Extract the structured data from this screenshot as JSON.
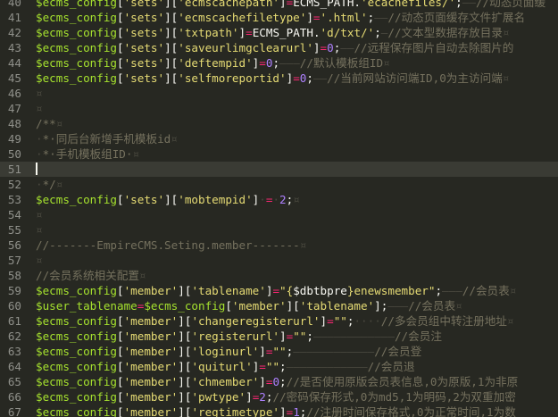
{
  "editor": {
    "theme_bg": "#272822",
    "active_line": 51,
    "lines": [
      {
        "n": "40",
        "tokens": [
          [
            "var",
            "$ecms_config"
          ],
          [
            "bracket",
            "["
          ],
          [
            "key",
            "'sets'"
          ],
          [
            "bracket",
            "]["
          ],
          [
            "key",
            "'ecmscachepath'"
          ],
          [
            "bracket",
            "]"
          ],
          [
            "op",
            "="
          ],
          [
            "plain",
            "ECMS_PATH."
          ],
          [
            "str",
            "'ecachefiles/'"
          ],
          [
            "plain",
            ";"
          ],
          [
            "ws",
            "——"
          ],
          [
            "comment",
            "//动态页面缓"
          ]
        ]
      },
      {
        "n": "41",
        "tokens": [
          [
            "var",
            "$ecms_config"
          ],
          [
            "bracket",
            "["
          ],
          [
            "key",
            "'sets'"
          ],
          [
            "bracket",
            "]["
          ],
          [
            "key",
            "'ecmscachefiletype'"
          ],
          [
            "bracket",
            "]"
          ],
          [
            "op",
            "="
          ],
          [
            "str",
            "'.html'"
          ],
          [
            "plain",
            ";"
          ],
          [
            "ws",
            "——"
          ],
          [
            "comment",
            "//动态页面缓存文件扩展名"
          ]
        ]
      },
      {
        "n": "42",
        "tokens": [
          [
            "var",
            "$ecms_config"
          ],
          [
            "bracket",
            "["
          ],
          [
            "key",
            "'sets'"
          ],
          [
            "bracket",
            "]["
          ],
          [
            "key",
            "'txtpath'"
          ],
          [
            "bracket",
            "]"
          ],
          [
            "op",
            "="
          ],
          [
            "plain",
            "ECMS_PATH."
          ],
          [
            "str",
            "'d/txt/'"
          ],
          [
            "plain",
            ";"
          ],
          [
            "ws",
            "—"
          ],
          [
            "comment",
            "//文本型数据存放目录"
          ],
          [
            "ws",
            "¤"
          ]
        ]
      },
      {
        "n": "43",
        "tokens": [
          [
            "var",
            "$ecms_config"
          ],
          [
            "bracket",
            "["
          ],
          [
            "key",
            "'sets'"
          ],
          [
            "bracket",
            "]["
          ],
          [
            "key",
            "'saveurlimgclearurl'"
          ],
          [
            "bracket",
            "]"
          ],
          [
            "op",
            "="
          ],
          [
            "num",
            "0"
          ],
          [
            "plain",
            ";"
          ],
          [
            "ws",
            "——"
          ],
          [
            "comment",
            "//远程保存图片自动去除图片的"
          ]
        ]
      },
      {
        "n": "44",
        "tokens": [
          [
            "var",
            "$ecms_config"
          ],
          [
            "bracket",
            "["
          ],
          [
            "key",
            "'sets'"
          ],
          [
            "bracket",
            "]["
          ],
          [
            "key",
            "'deftempid'"
          ],
          [
            "bracket",
            "]"
          ],
          [
            "op",
            "="
          ],
          [
            "num",
            "0"
          ],
          [
            "plain",
            ";"
          ],
          [
            "ws",
            "———"
          ],
          [
            "comment",
            "//默认模板组ID"
          ],
          [
            "ws",
            "¤"
          ]
        ]
      },
      {
        "n": "45",
        "tokens": [
          [
            "var",
            "$ecms_config"
          ],
          [
            "bracket",
            "["
          ],
          [
            "key",
            "'sets'"
          ],
          [
            "bracket",
            "]["
          ],
          [
            "key",
            "'selfmoreportid'"
          ],
          [
            "bracket",
            "]"
          ],
          [
            "op",
            "="
          ],
          [
            "num",
            "0"
          ],
          [
            "plain",
            ";"
          ],
          [
            "ws",
            "——"
          ],
          [
            "comment",
            "//当前网站访问端ID,0为主访问端"
          ],
          [
            "ws",
            "¤"
          ]
        ]
      },
      {
        "n": "46",
        "tokens": [
          [
            "ws",
            "¤"
          ]
        ]
      },
      {
        "n": "47",
        "tokens": [
          [
            "ws",
            "¤"
          ]
        ]
      },
      {
        "n": "48",
        "tokens": [
          [
            "comment",
            "/**"
          ],
          [
            "ws",
            "¤"
          ]
        ]
      },
      {
        "n": "49",
        "tokens": [
          [
            "ws",
            "·"
          ],
          [
            "comment",
            "*·同后台新增手机模板id"
          ],
          [
            "ws",
            "¤"
          ]
        ]
      },
      {
        "n": "50",
        "tokens": [
          [
            "ws",
            "·"
          ],
          [
            "comment",
            "*·手机模板组ID·"
          ],
          [
            "ws",
            "¤"
          ]
        ]
      },
      {
        "n": "51",
        "tokens": [
          [
            "cursor",
            ""
          ]
        ]
      },
      {
        "n": "52",
        "tokens": [
          [
            "ws",
            "·"
          ],
          [
            "comment",
            "*/"
          ],
          [
            "ws",
            "¤"
          ]
        ]
      },
      {
        "n": "53",
        "tokens": [
          [
            "var",
            "$ecms_config"
          ],
          [
            "bracket",
            "["
          ],
          [
            "key",
            "'sets'"
          ],
          [
            "bracket",
            "]["
          ],
          [
            "key",
            "'mobtempid'"
          ],
          [
            "bracket",
            "]"
          ],
          [
            "ws",
            "·"
          ],
          [
            "op",
            "="
          ],
          [
            "ws",
            "·"
          ],
          [
            "num",
            "2"
          ],
          [
            "plain",
            ";"
          ],
          [
            "ws",
            "¤"
          ]
        ]
      },
      {
        "n": "54",
        "tokens": [
          [
            "ws",
            "¤"
          ]
        ]
      },
      {
        "n": "55",
        "tokens": [
          [
            "ws",
            "¤"
          ]
        ]
      },
      {
        "n": "56",
        "tokens": [
          [
            "comment",
            "//-------EmpireCMS.Seting.member-------"
          ],
          [
            "ws",
            "¤"
          ]
        ]
      },
      {
        "n": "57",
        "tokens": [
          [
            "ws",
            "¤"
          ]
        ]
      },
      {
        "n": "58",
        "tokens": [
          [
            "comment",
            "//会员系统相关配置"
          ],
          [
            "ws",
            "¤"
          ]
        ]
      },
      {
        "n": "59",
        "tokens": [
          [
            "var",
            "$ecms_config"
          ],
          [
            "bracket",
            "["
          ],
          [
            "key",
            "'member'"
          ],
          [
            "bracket",
            "]["
          ],
          [
            "key",
            "'tablename'"
          ],
          [
            "bracket",
            "]"
          ],
          [
            "op",
            "="
          ],
          [
            "str",
            "\"{"
          ],
          [
            "plain",
            "$dbtbpre"
          ],
          [
            "str",
            "}enewsmember\""
          ],
          [
            "plain",
            ";"
          ],
          [
            "ws",
            "———"
          ],
          [
            "comment",
            "//会员表"
          ],
          [
            "ws",
            "¤"
          ]
        ]
      },
      {
        "n": "60",
        "tokens": [
          [
            "var",
            "$user_tablename"
          ],
          [
            "op",
            "="
          ],
          [
            "var",
            "$ecms_config"
          ],
          [
            "bracket",
            "["
          ],
          [
            "key",
            "'member'"
          ],
          [
            "bracket",
            "]["
          ],
          [
            "key",
            "'tablename'"
          ],
          [
            "bracket",
            "]"
          ],
          [
            "plain",
            ";"
          ],
          [
            "ws",
            "———"
          ],
          [
            "comment",
            "//会员表"
          ],
          [
            "ws",
            "¤"
          ]
        ]
      },
      {
        "n": "61",
        "tokens": [
          [
            "var",
            "$ecms_config"
          ],
          [
            "bracket",
            "["
          ],
          [
            "key",
            "'member'"
          ],
          [
            "bracket",
            "]["
          ],
          [
            "key",
            "'changeregisterurl'"
          ],
          [
            "bracket",
            "]"
          ],
          [
            "op",
            "="
          ],
          [
            "str",
            "\"\""
          ],
          [
            "plain",
            ";"
          ],
          [
            "ws",
            "····"
          ],
          [
            "comment",
            "//多会员组中转注册地址"
          ],
          [
            "ws",
            "¤"
          ]
        ]
      },
      {
        "n": "62",
        "tokens": [
          [
            "var",
            "$ecms_config"
          ],
          [
            "bracket",
            "["
          ],
          [
            "key",
            "'member'"
          ],
          [
            "bracket",
            "]["
          ],
          [
            "key",
            "'registerurl'"
          ],
          [
            "bracket",
            "]"
          ],
          [
            "op",
            "="
          ],
          [
            "str",
            "\"\""
          ],
          [
            "plain",
            ";"
          ],
          [
            "ws",
            "————————————"
          ],
          [
            "comment",
            "//会员注"
          ]
        ]
      },
      {
        "n": "63",
        "tokens": [
          [
            "var",
            "$ecms_config"
          ],
          [
            "bracket",
            "["
          ],
          [
            "key",
            "'member'"
          ],
          [
            "bracket",
            "]["
          ],
          [
            "key",
            "'loginurl'"
          ],
          [
            "bracket",
            "]"
          ],
          [
            "op",
            "="
          ],
          [
            "str",
            "\"\""
          ],
          [
            "plain",
            ";"
          ],
          [
            "ws",
            "————————————"
          ],
          [
            "comment",
            "//会员登"
          ]
        ]
      },
      {
        "n": "64",
        "tokens": [
          [
            "var",
            "$ecms_config"
          ],
          [
            "bracket",
            "["
          ],
          [
            "key",
            "'member'"
          ],
          [
            "bracket",
            "]["
          ],
          [
            "key",
            "'quiturl'"
          ],
          [
            "bracket",
            "]"
          ],
          [
            "op",
            "="
          ],
          [
            "str",
            "\"\""
          ],
          [
            "plain",
            ";"
          ],
          [
            "ws",
            "————————————"
          ],
          [
            "comment",
            "//会员退"
          ]
        ]
      },
      {
        "n": "65",
        "tokens": [
          [
            "var",
            "$ecms_config"
          ],
          [
            "bracket",
            "["
          ],
          [
            "key",
            "'member'"
          ],
          [
            "bracket",
            "]["
          ],
          [
            "key",
            "'chmember'"
          ],
          [
            "bracket",
            "]"
          ],
          [
            "op",
            "="
          ],
          [
            "num",
            "0"
          ],
          [
            "plain",
            ";"
          ],
          [
            "comment",
            "//是否使用原版会员表信息,0为原版,1为非原"
          ]
        ]
      },
      {
        "n": "66",
        "tokens": [
          [
            "var",
            "$ecms_config"
          ],
          [
            "bracket",
            "["
          ],
          [
            "key",
            "'member'"
          ],
          [
            "bracket",
            "]["
          ],
          [
            "key",
            "'pwtype'"
          ],
          [
            "bracket",
            "]"
          ],
          [
            "op",
            "="
          ],
          [
            "num",
            "2"
          ],
          [
            "plain",
            ";"
          ],
          [
            "comment",
            "//密码保存形式,0为md5,1为明码,2为双重加密"
          ]
        ]
      },
      {
        "n": "67",
        "tokens": [
          [
            "var",
            "$ecms_config"
          ],
          [
            "bracket",
            "["
          ],
          [
            "key",
            "'member'"
          ],
          [
            "bracket",
            "]["
          ],
          [
            "key",
            "'regtimetype'"
          ],
          [
            "bracket",
            "]"
          ],
          [
            "op",
            "="
          ],
          [
            "num",
            "1"
          ],
          [
            "plain",
            ";"
          ],
          [
            "comment",
            "//注册时间保存格式,0为正常时间,1为数"
          ]
        ]
      }
    ]
  }
}
